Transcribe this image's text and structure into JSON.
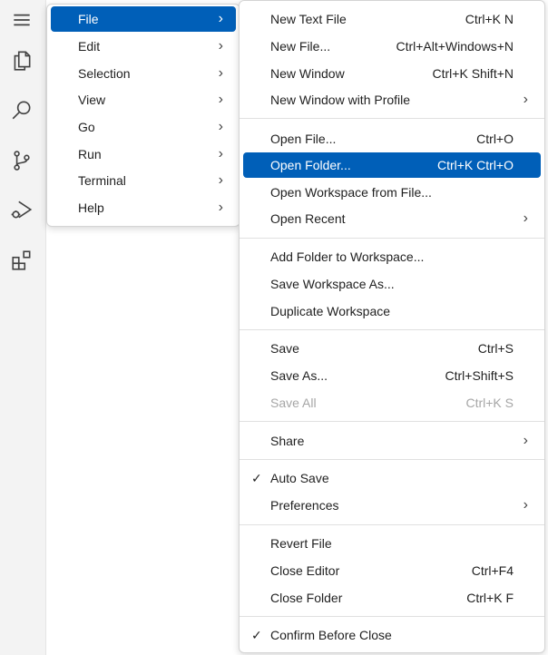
{
  "activity_bar": {
    "icons": [
      "menu-icon",
      "files-icon",
      "search-icon",
      "source-control-icon",
      "run-debug-icon",
      "extensions-icon"
    ]
  },
  "main_menu": {
    "items": [
      {
        "label": "File",
        "active": true
      },
      {
        "label": "Edit"
      },
      {
        "label": "Selection"
      },
      {
        "label": "View"
      },
      {
        "label": "Go"
      },
      {
        "label": "Run"
      },
      {
        "label": "Terminal"
      },
      {
        "label": "Help"
      }
    ]
  },
  "file_menu": {
    "items": [
      {
        "label": "New Text File",
        "shortcut": "Ctrl+K N"
      },
      {
        "label": "New File...",
        "shortcut": "Ctrl+Alt+Windows+N"
      },
      {
        "label": "New Window",
        "shortcut": "Ctrl+K Shift+N"
      },
      {
        "label": "New Window with Profile",
        "submenu": true
      },
      {
        "label": "Open File...",
        "shortcut": "Ctrl+O"
      },
      {
        "label": "Open Folder...",
        "shortcut": "Ctrl+K Ctrl+O",
        "active": true
      },
      {
        "label": "Open Workspace from File..."
      },
      {
        "label": "Open Recent",
        "submenu": true
      },
      {
        "label": "Add Folder to Workspace..."
      },
      {
        "label": "Save Workspace As..."
      },
      {
        "label": "Duplicate Workspace"
      },
      {
        "label": "Save",
        "shortcut": "Ctrl+S"
      },
      {
        "label": "Save As...",
        "shortcut": "Ctrl+Shift+S"
      },
      {
        "label": "Save All",
        "shortcut": "Ctrl+K S",
        "disabled": true
      },
      {
        "label": "Share",
        "submenu": true
      },
      {
        "label": "Auto Save",
        "checked": true
      },
      {
        "label": "Preferences",
        "submenu": true
      },
      {
        "label": "Revert File"
      },
      {
        "label": "Close Editor",
        "shortcut": "Ctrl+F4"
      },
      {
        "label": "Close Folder",
        "shortcut": "Ctrl+K F"
      },
      {
        "label": "Confirm Before Close",
        "checked": true
      }
    ]
  },
  "glyphs": {
    "chevron": "›",
    "check": "✓"
  },
  "colors": {
    "accent": "#005fb8",
    "disabled": "#a6a6a6"
  }
}
